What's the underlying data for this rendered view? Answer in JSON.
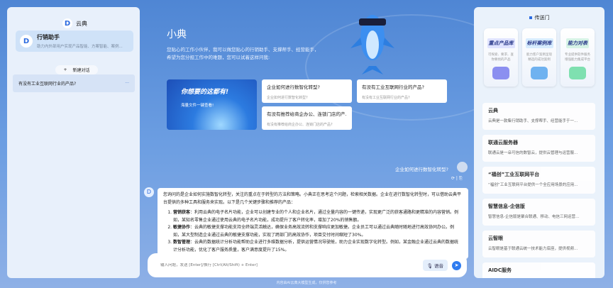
{
  "app": {
    "name": "云典"
  },
  "sidebar": {
    "assistant": {
      "name": "行销助手",
      "desc": "助力内外部用户实现产品智能、方案智能、案例..."
    },
    "new_chat": "新建对话",
    "history": [
      {
        "title": "有没有工业互联网行业的产品?"
      }
    ],
    "more": "···"
  },
  "main": {
    "title": "小典",
    "desc_line1": "您贴心的工作小伙伴，我可以做您贴心的行销助手、支撑帮手、经营能手，",
    "desc_line2": "希望为您分担工作中的难题，您可以试着这样问我:",
    "banner": {
      "title": "你想要的这都有!",
      "subtitle": "海量文件一键查看!"
    },
    "suggestions": [
      {
        "title": "企业如何进行数智化转型?",
        "sub": "企业如何进行数智化转型?"
      },
      {
        "title": "有没有工业互联网行业的产品?",
        "sub": "有没有工业互联网行业的产品?"
      },
      {
        "title": "有没有推荐给商企办公、连锁门店的产...",
        "sub": "有没有推荐给商企办公、连锁门店的产品?"
      }
    ],
    "user_message": "企业如何进行数智化转型?",
    "msg_actions": "⟳ | ⎘",
    "answer": {
      "intro": "您询问的是企业如何实施数智化转型，关注的重点在于转型的方法和策略。小典正在思考这个问题，检索相关数据。企业在进行数智化转型时，可以借助云典平台提供的多种工具和服务来实现。以下是几个关键步骤和推荐的产品：",
      "points": [
        {
          "head": "营销获客",
          "body": "：利用云典的电子名片功能，企业可以创建专业的个人和企业名片，通过全量内容的一键传递，实现更广泛的获客通路和更精准的内容营销。例如，某知名零售企业通过使用云典的电子名片功能，成功提升了客户转化率，增加了20%的销售额。"
        },
        {
          "head": "敏捷协作",
          "body": "：云典的敏捷支撑功能支持全终端灵活触达，确保业务高效流转和支撑响应更加敏捷。企业员工可以通过云典随时随地进行高效协同办公。例如，某大型制造企业通过云典的敏捷支撑功能，实现了跨部门的高效协作，项目交付时间缩短了30%。"
        },
        {
          "head": "数智管理",
          "body": "：云典的数据统计分析功能帮助企业进行多维数据分析，提供运营情况导驶舱，助力企业实现数字化转型。例如，某金融企业通过云典的数据统计分析功能，优化了客户服务质量，客户满意度提升了15%。"
        }
      ]
    },
    "input_placeholder": "输入问题，发送 [Enter]/换行 [Ctrl(Alt/Shift) + Enter]",
    "voice_label": "语音",
    "footer": "内容由AI云典大模型生成，仅供您参考"
  },
  "portal": {
    "title": "传送门",
    "tiles": [
      {
        "title": "重点产品库",
        "desc": "可探索、要求、查你要找的产品"
      },
      {
        "title": "标杆案例库",
        "desc": "能力客户案例呈现精选的成功案例"
      },
      {
        "title": "能力对表",
        "desc": "专业提供软件服务增强能力集成平台"
      }
    ],
    "items": [
      {
        "title": "云典",
        "desc": "云典是一款集行销助手、支撑帮手、经营能手于一..."
      },
      {
        "title": "联通云服务器",
        "desc": "联通云是一朵可信的数智云，提供云管理与运营服..."
      },
      {
        "title": "“福创”工业互联网平台",
        "desc": "“福创”工业互联网平台提供一个全应用场景的应用..."
      },
      {
        "title": "智慧信息-企信版",
        "desc": "智慧信息-企信版是聚合联通、移动、电信三网运营..."
      },
      {
        "title": "云智眼",
        "desc": "云智眼是基于联通云统一技术能力底座，提供视频..."
      },
      {
        "title": "AIDC服务",
        "desc": ""
      }
    ]
  },
  "colors": {
    "accent": "#2c6be0"
  }
}
